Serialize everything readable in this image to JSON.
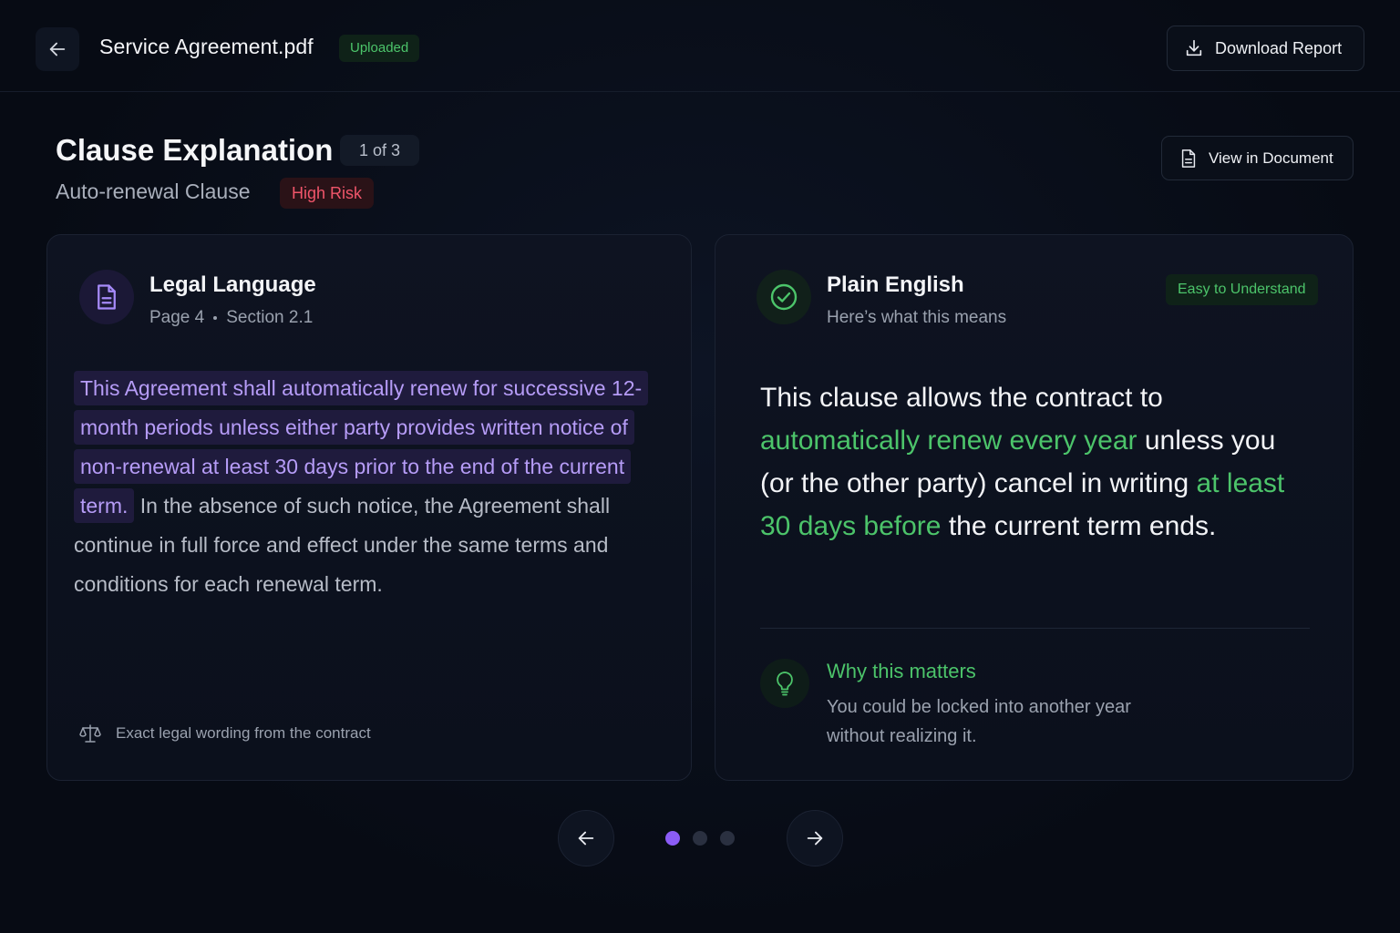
{
  "header": {
    "back_icon": "arrow-left-icon",
    "file_name": "Service Agreement.pdf",
    "status_badge": "Uploaded",
    "download_label": "Download Report",
    "download_icon": "download-icon"
  },
  "clause": {
    "title": "Clause Explanation",
    "position": "1 of 3",
    "name": "Auto-renewal Clause",
    "risk": "High Risk",
    "view_doc_label": "View in Document",
    "view_doc_icon": "document-icon"
  },
  "legal_card": {
    "icon": "document-icon",
    "heading": "Legal Language",
    "page": "Page 4",
    "section": "Section 2.1",
    "highlighted_text": "This Agreement shall automatically renew for successive 12-month periods unless either party provides written notice of non-renewal at least 30 days prior to the end of the current term.",
    "remaining_text": " In the absence of such notice, the Agreement shall continue in full force and effect under the same terms and conditions for each renewal term.",
    "footer_icon": "scale-icon",
    "footer_text": "Exact legal wording from the contract"
  },
  "plain_card": {
    "icon": "check-circle-icon",
    "heading": "Plain English",
    "subheading": "Here’s what this means",
    "badge": "Easy to Understand",
    "text_part1": "This clause allows the contract to ",
    "text_green1": "automatically renew every year",
    "text_part2": " unless you (or the other party) cancel in writing ",
    "text_green2": "at least 30 days before",
    "text_part3": " the current term ends.",
    "why_icon": "lightbulb-icon",
    "why_title": "Why this matters",
    "why_text": "You could be locked into another year without realizing it."
  },
  "pager": {
    "prev_icon": "arrow-left-icon",
    "next_icon": "arrow-right-icon",
    "total": 3,
    "current": 1
  },
  "colors": {
    "accent_purple": "#8b5cf6",
    "accent_green": "#4cc46a",
    "risk_red": "#f0556a"
  }
}
